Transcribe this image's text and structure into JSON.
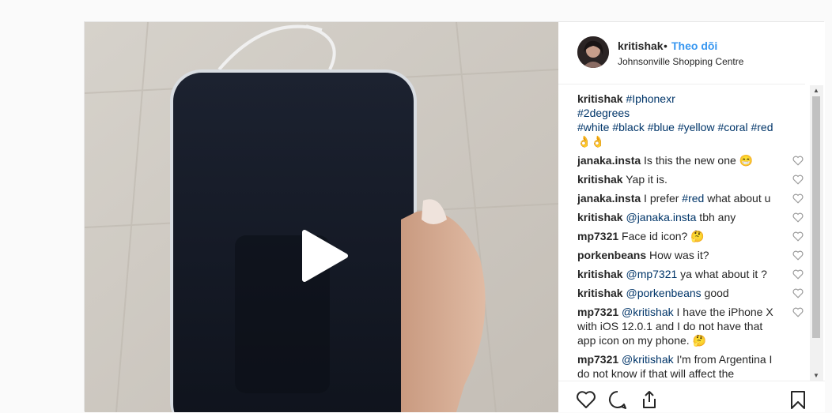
{
  "post": {
    "username": "kritishak",
    "separator": "•",
    "follow_label": "Theo dõi",
    "location": "Johnsonville Shopping Centre"
  },
  "caption": {
    "author": "kritishak",
    "line1": "#Iphonexr",
    "line2": "#2degrees",
    "line3": "#white #black #blue #yellow #coral #red",
    "line4": "👌👌"
  },
  "comments": [
    {
      "user": "janaka.insta",
      "text": "Is this the new one 😁"
    },
    {
      "user": "kritishak",
      "text": "Yap it is."
    },
    {
      "user": "janaka.insta",
      "text": "I prefer ",
      "tag": "#red",
      "after": " what about u"
    },
    {
      "user": "kritishak",
      "tag": "@janaka.insta",
      "after": " tbh any"
    },
    {
      "user": "mp7321",
      "text": "Face id icon? 🤔"
    },
    {
      "user": "porkenbeans",
      "text": "How was it?"
    },
    {
      "user": "kritishak",
      "tag": "@mp7321",
      "after": " ya what about it ?"
    },
    {
      "user": "kritishak",
      "tag": "@porkenbeans",
      "after": " good"
    },
    {
      "user": "mp7321",
      "tag": "@kritishak",
      "after": " I have the iPhone X with iOS 12.0.1 and I do not have that app icon on my phone. 🤔"
    },
    {
      "user": "mp7321",
      "tag": "@kritishak",
      "after": " I'm from Argentina I do not know if that will affect the"
    }
  ],
  "icons": {
    "like": "heart-icon",
    "comment": "comment-icon",
    "share": "share-icon",
    "save": "bookmark-icon",
    "play": "play-icon"
  },
  "colors": {
    "link": "#3897f0",
    "tag": "#003569",
    "text": "#262626"
  }
}
